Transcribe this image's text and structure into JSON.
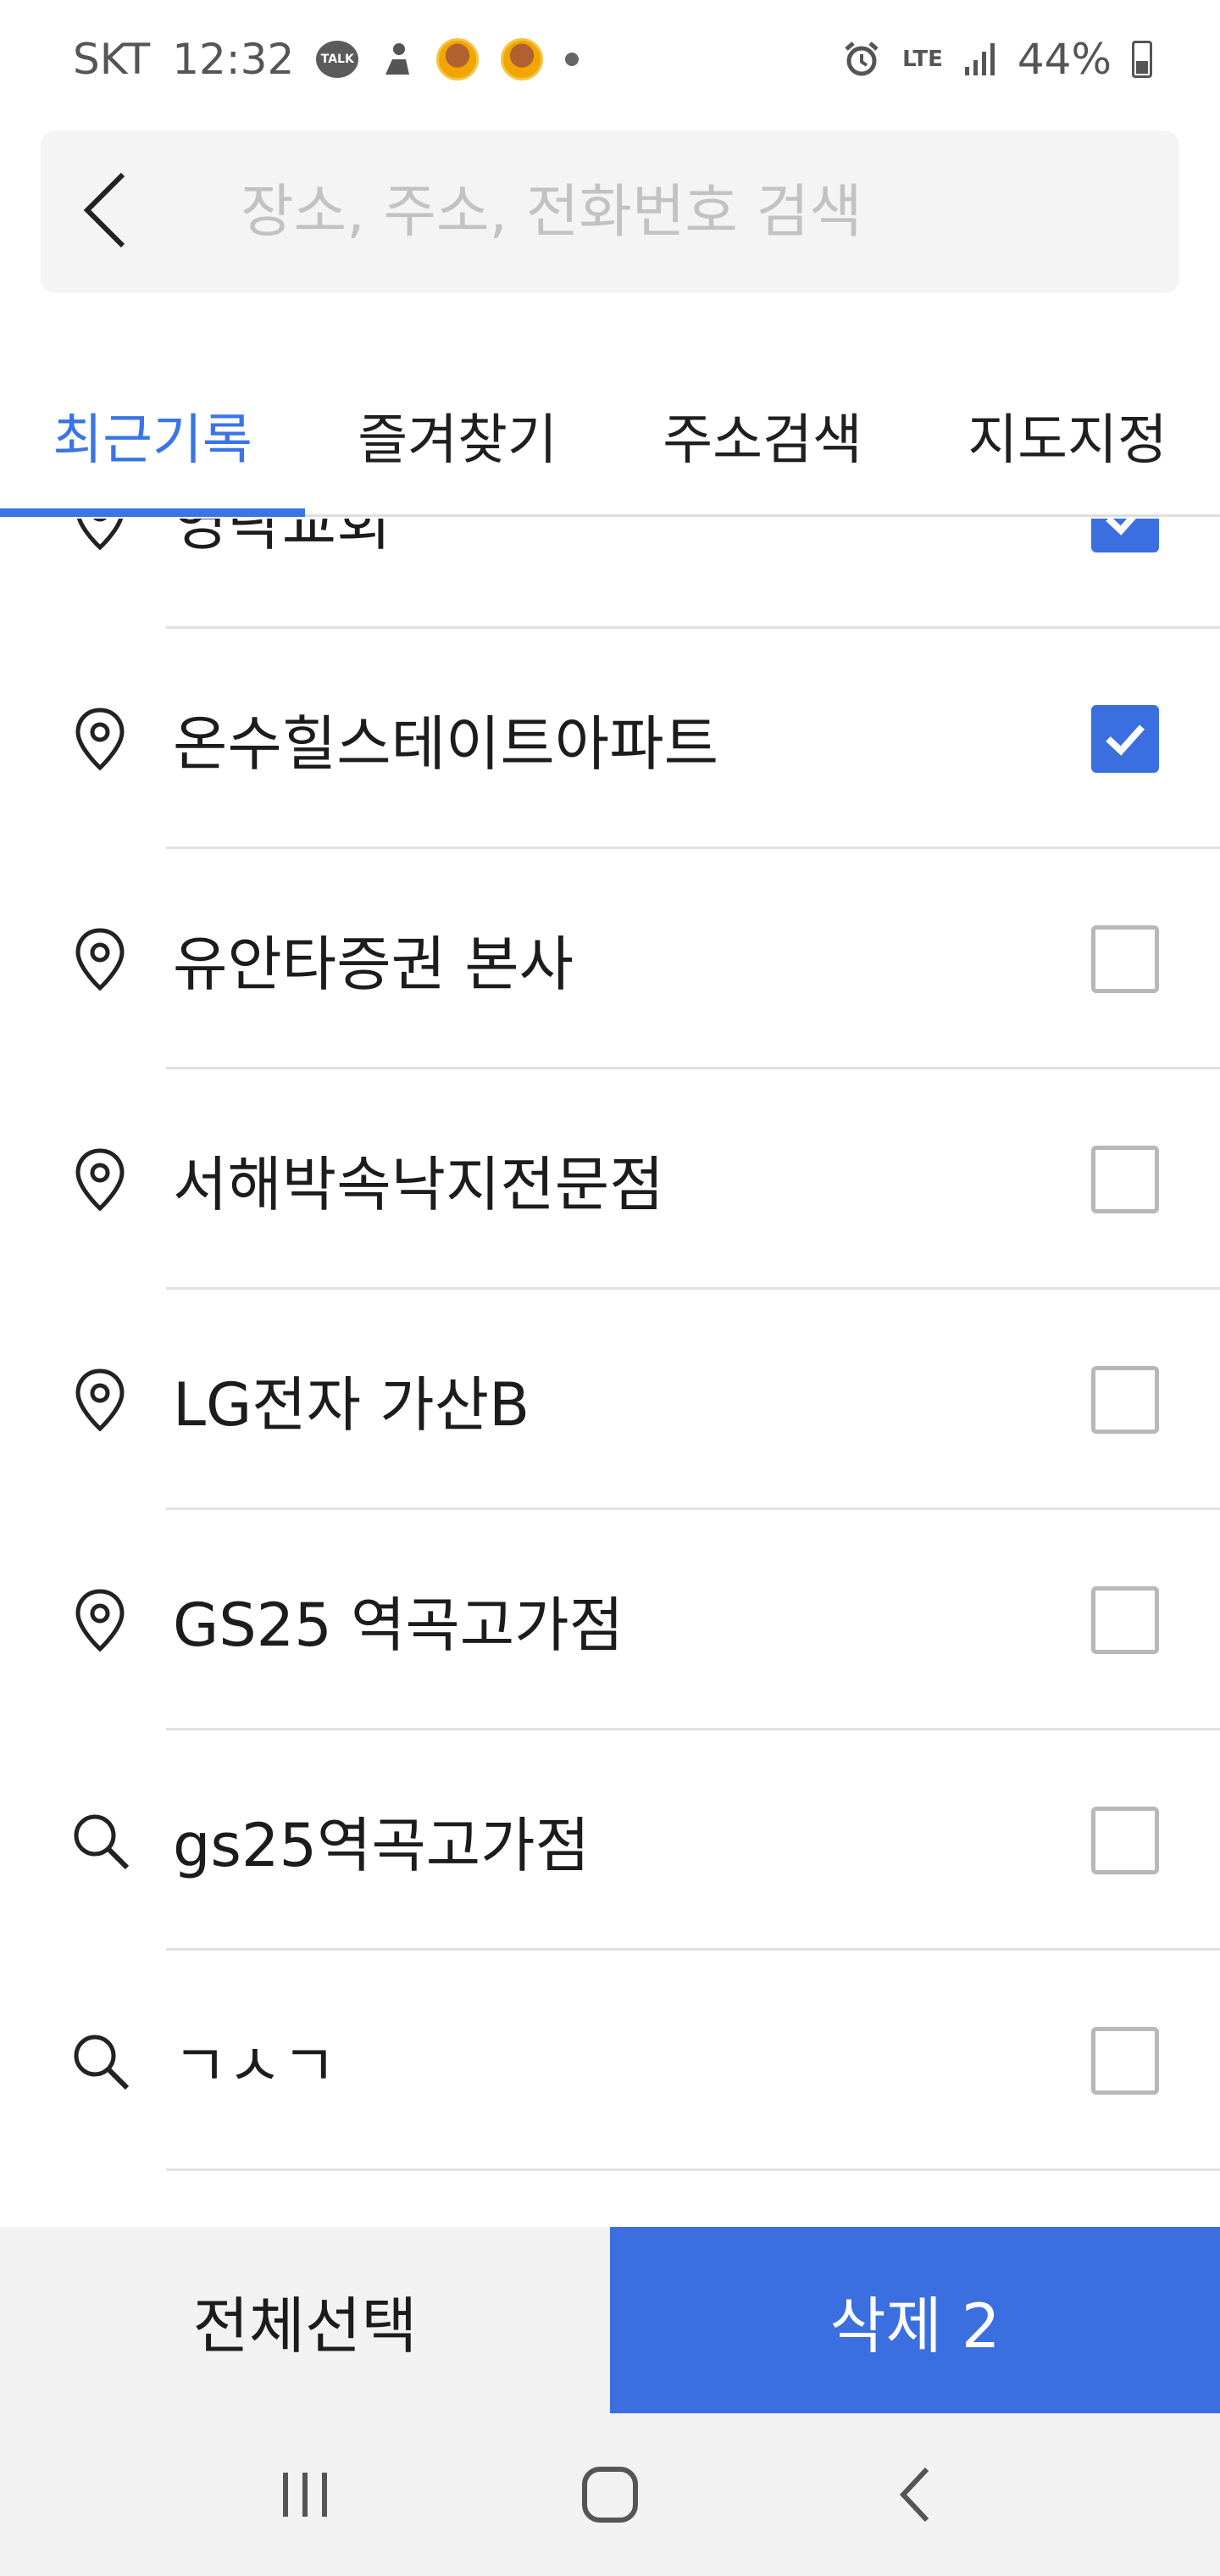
{
  "status_bar": {
    "carrier": "SKT",
    "time": "12:32",
    "talk_icon_text": "TALK",
    "network": "LTE",
    "battery": "44%"
  },
  "search": {
    "placeholder": "장소, 주소, 전화번호 검색"
  },
  "tabs": [
    {
      "label": "최근기록",
      "active": true
    },
    {
      "label": "즐겨찾기",
      "active": false
    },
    {
      "label": "주소검색",
      "active": false
    },
    {
      "label": "지도지정",
      "active": false
    }
  ],
  "items": [
    {
      "icon": "location-pin-icon",
      "label": "영락교회",
      "checked": true
    },
    {
      "icon": "location-pin-icon",
      "label": "온수힐스테이트아파트",
      "checked": true
    },
    {
      "icon": "location-pin-icon",
      "label": "유안타증권 본사",
      "checked": false
    },
    {
      "icon": "location-pin-icon",
      "label": "서해박속낙지전문점",
      "checked": false
    },
    {
      "icon": "location-pin-icon",
      "label": "LG전자 가산B",
      "checked": false
    },
    {
      "icon": "location-pin-icon",
      "label": "GS25 역곡고가점",
      "checked": false
    },
    {
      "icon": "search-icon",
      "label": "gs25역곡고가점",
      "checked": false
    },
    {
      "icon": "search-icon",
      "label": "ㄱㅅㄱ",
      "checked": false
    }
  ],
  "actions": {
    "select_all": "전체선택",
    "delete": "삭제 2"
  },
  "colors": {
    "accent": "#3b6fe0",
    "tab_active": "#3b74e6"
  }
}
